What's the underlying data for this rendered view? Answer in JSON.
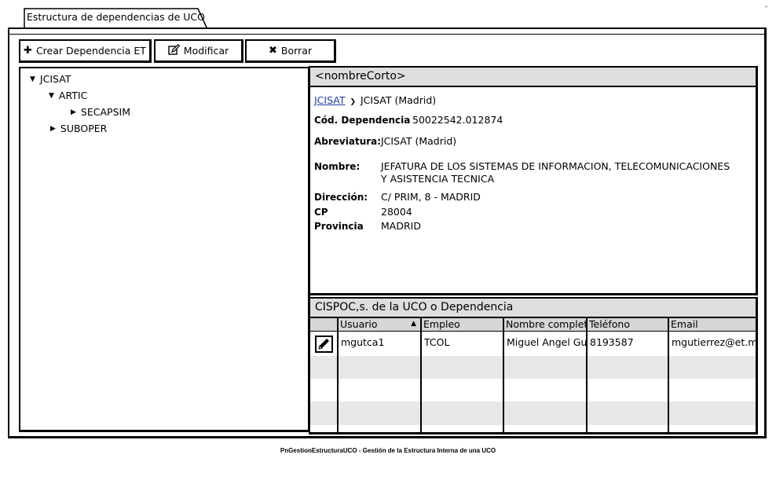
{
  "tab": {
    "title": "Estructura de dependencias de UCO"
  },
  "toolbar": {
    "create_label": "Crear Dependencia ET",
    "modify_label": "Modificar",
    "delete_label": "Borrar"
  },
  "tree": {
    "items": [
      {
        "label": "JCISAT",
        "state": "expanded"
      },
      {
        "label": "ARTIC",
        "state": "expanded"
      },
      {
        "label": "SECAPSIM",
        "state": "collapsed"
      },
      {
        "label": "SUBOPER",
        "state": "collapsed"
      }
    ]
  },
  "detail": {
    "header": "<nombreCorto>",
    "breadcrumb": {
      "link": "JCISAT",
      "current": "JCISAT (Madrid)"
    },
    "fields": {
      "cod_label": "Cód. Dependencia",
      "cod_value": "50022542.012874",
      "abrev_label": "Abreviatura:",
      "abrev_value": "JCISAT (Madrid)",
      "nombre_label": "Nombre:",
      "nombre_value_line1": "JEFATURA DE LOS SISTEMAS DE INFORMACION, TELECOMUNICACIONES",
      "nombre_value_line2": "Y ASISTENCIA TECNICA",
      "direccion_label": "Dirección:",
      "direccion_value": "C/ PRIM, 8 - MADRID",
      "cp_label": "CP",
      "cp_value": "28004",
      "provincia_label": "Provincia",
      "provincia_value": "MADRID"
    }
  },
  "grid": {
    "header": "CISPOC,s. de la UCO o Dependencia",
    "columns": [
      "Usuario",
      "Empleo",
      "Nombre completo",
      "Teléfono",
      "Email"
    ],
    "sort_indicator": "▲",
    "rows": [
      {
        "usuario": "mgutca1",
        "empleo": "TCOL",
        "nombre": "Miguel Angel Gutierrez",
        "telefono": "8193587",
        "email": "mgutierrez@et.mde.es"
      }
    ]
  },
  "footer": {
    "text": "PnGestionEstructuraUCO - Gestión de la Estructura Interna de una UCO"
  },
  "icons": {
    "create": "plus-icon",
    "modify": "edit-icon",
    "delete": "x-icon",
    "row_edit": "pencil-icon",
    "tree_expanded": "triangle-down-icon",
    "tree_collapsed": "triangle-right-icon"
  }
}
